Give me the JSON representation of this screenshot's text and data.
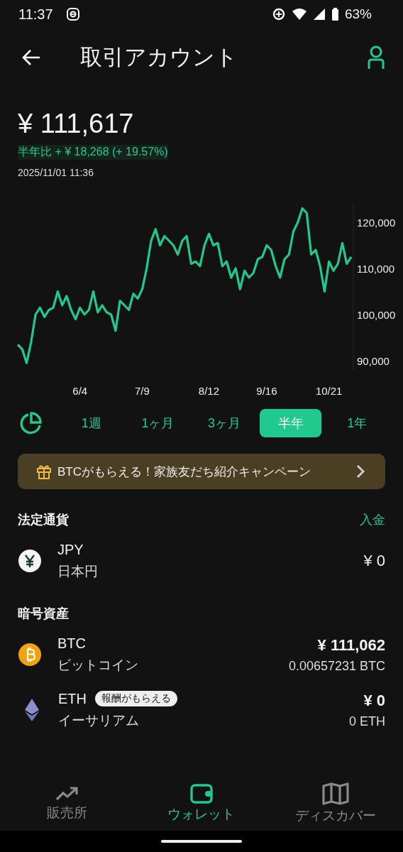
{
  "status_bar": {
    "time": "11:37",
    "battery": "63%"
  },
  "header": {
    "title": "取引アカウント"
  },
  "balance": {
    "amount": "¥ 111,617",
    "change_label": "半年比",
    "change": "+ ¥ 18,268 (+ 19.57%)",
    "timestamp": "2025/11/01 11:36"
  },
  "chart_data": {
    "type": "line",
    "ylim": [
      88000,
      124000
    ],
    "yticks": [
      {
        "value": 90000,
        "label": "90,000"
      },
      {
        "value": 100000,
        "label": "100,000"
      },
      {
        "value": 110000,
        "label": "110,000"
      },
      {
        "value": 120000,
        "label": "120,000"
      }
    ],
    "categories": [
      null,
      null,
      null,
      null,
      null,
      null,
      null,
      null,
      null,
      null,
      null,
      null,
      null,
      null,
      "6/4",
      null,
      null,
      null,
      null,
      null,
      null,
      null,
      null,
      null,
      null,
      null,
      null,
      null,
      "7/9",
      null,
      null,
      null,
      null,
      null,
      null,
      null,
      null,
      null,
      null,
      null,
      null,
      null,
      null,
      "8/12",
      null,
      null,
      null,
      null,
      null,
      null,
      null,
      null,
      null,
      null,
      null,
      null,
      "9/16",
      null,
      null,
      null,
      null,
      null,
      null,
      null,
      null,
      null,
      null,
      null,
      null,
      null,
      "10/21",
      null,
      null,
      null,
      null,
      null
    ],
    "series": [
      {
        "color": "#22c98f",
        "values": [
          93500,
          92500,
          89500,
          94000,
          100000,
          101500,
          99500,
          101000,
          101500,
          105000,
          102000,
          104000,
          101000,
          99000,
          101500,
          100000,
          101000,
          105000,
          100500,
          102000,
          100500,
          100000,
          96500,
          103000,
          102000,
          101000,
          104500,
          103500,
          105500,
          110000,
          116000,
          118500,
          115000,
          117000,
          116000,
          115000,
          113000,
          116000,
          117000,
          111000,
          111500,
          110500,
          115000,
          117500,
          115000,
          115500,
          110500,
          111500,
          108000,
          110000,
          105500,
          109500,
          108000,
          109000,
          112000,
          112500,
          115000,
          114000,
          110500,
          108000,
          112000,
          113000,
          118000,
          120000,
          123000,
          122000,
          113000,
          114000,
          110500,
          105000,
          111500,
          109500,
          111000,
          115500,
          111000,
          112500
        ]
      }
    ]
  },
  "periods": [
    {
      "label": "1週",
      "selected": false
    },
    {
      "label": "1ヶ月",
      "selected": false
    },
    {
      "label": "3ヶ月",
      "selected": false
    },
    {
      "label": "半年",
      "selected": true
    },
    {
      "label": "1年",
      "selected": false
    }
  ],
  "banner": {
    "text": "BTCがもらえる！家族友だち紹介キャンペーン"
  },
  "fiat": {
    "title": "法定通貨",
    "action": "入金",
    "rows": [
      {
        "kind": "yen",
        "code": "JPY",
        "name": "日本円",
        "value": "¥ 0"
      }
    ]
  },
  "crypto": {
    "title": "暗号資産",
    "rows": [
      {
        "kind": "btc",
        "code": "BTC",
        "name": "ビットコイン",
        "value": "¥ 111,062",
        "amount": "0.00657231 BTC"
      },
      {
        "kind": "eth",
        "code": "ETH",
        "badge": "報酬がもらえる",
        "name": "イーサリアム",
        "value": "¥ 0",
        "amount": "0 ETH"
      }
    ]
  },
  "bottom_nav": [
    {
      "kind": "trend",
      "label": "販売所",
      "selected": false
    },
    {
      "kind": "wallet",
      "label": "ウォレット",
      "selected": true
    },
    {
      "kind": "map",
      "label": "ディスカバー",
      "selected": false
    }
  ]
}
